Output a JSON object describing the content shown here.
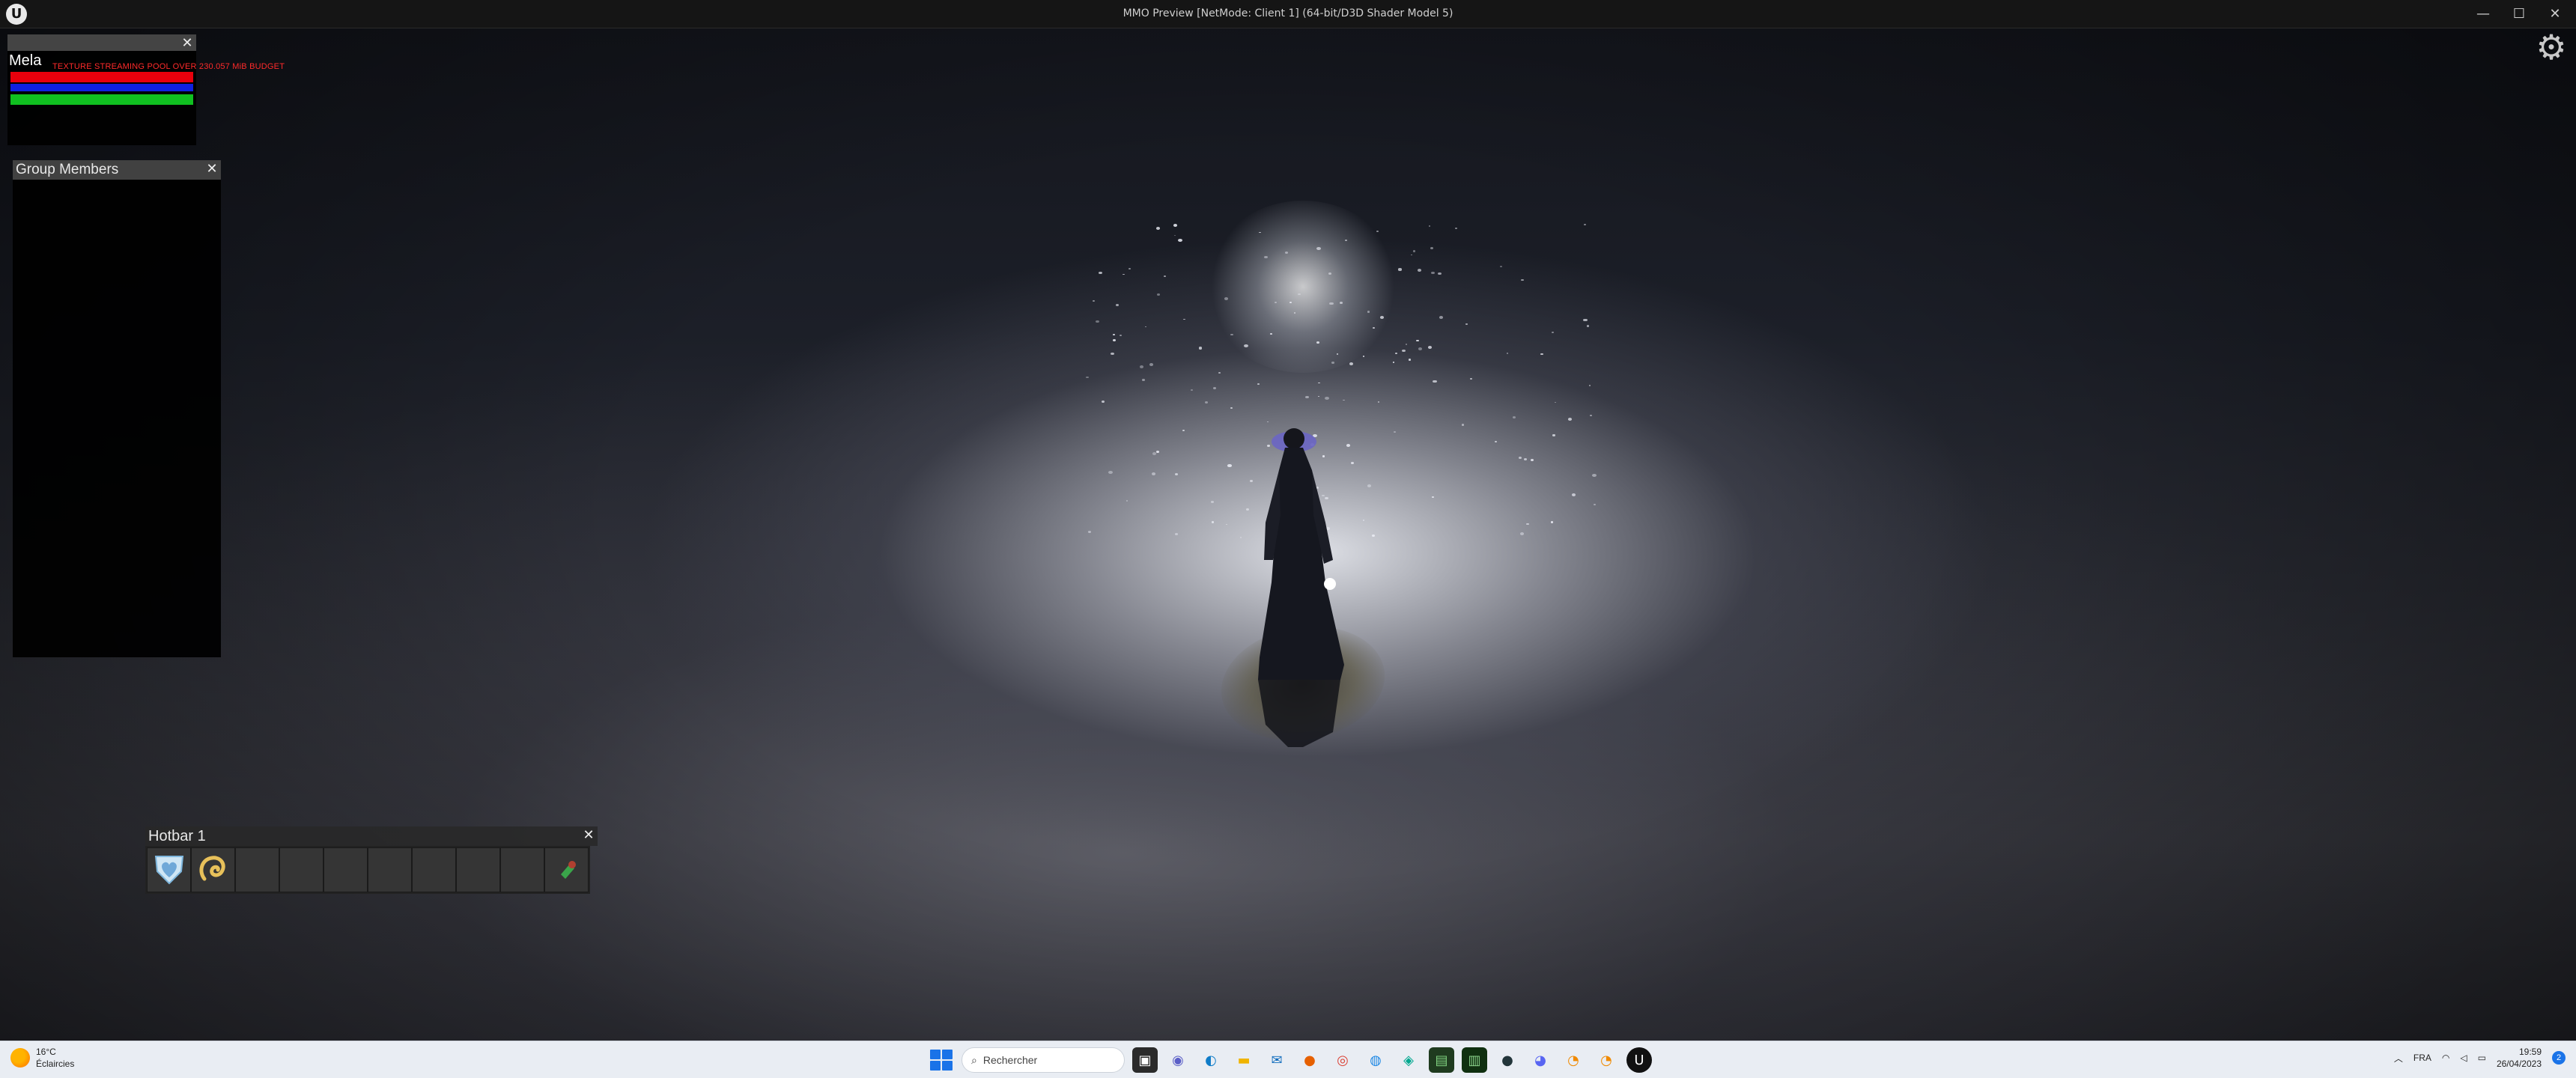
{
  "window": {
    "title": "MMO Preview [NetMode: Client 1]  (64-bit/D3D Shader Model 5)",
    "logo": "U",
    "minimize": "—",
    "maximize": "☐",
    "close": "✕"
  },
  "hud": {
    "character_frame": {
      "name": "Mela",
      "debug_message": "TEXTURE STREAMING POOL OVER 230.057 MiB BUDGET",
      "bars": [
        {
          "name": "health",
          "color": "#e8000c",
          "fill": 1.0
        },
        {
          "name": "mana",
          "color": "#1020e0",
          "fill": 1.0
        },
        {
          "name": "stamina",
          "color": "#10c020",
          "fill": 1.0
        }
      ],
      "close": "✕"
    },
    "group_members": {
      "title": "Group Members",
      "close": "✕"
    },
    "hotbar": {
      "title": "Hotbar 1",
      "close": "✕",
      "slot_count": 10,
      "slots": [
        {
          "icon": "heart-shield-icon"
        },
        {
          "icon": "gold-swirl-icon"
        },
        {
          "icon": ""
        },
        {
          "icon": ""
        },
        {
          "icon": ""
        },
        {
          "icon": ""
        },
        {
          "icon": ""
        },
        {
          "icon": ""
        },
        {
          "icon": ""
        },
        {
          "icon": "green-potion-icon"
        }
      ]
    },
    "settings_icon": "⚙"
  },
  "taskbar": {
    "weather": {
      "temp": "16°C",
      "condition": "Éclaircies"
    },
    "search_placeholder": "Rechercher",
    "tray": {
      "language": "FRA",
      "time": "19:59",
      "date": "26/04/2023",
      "notifications": "2"
    }
  }
}
